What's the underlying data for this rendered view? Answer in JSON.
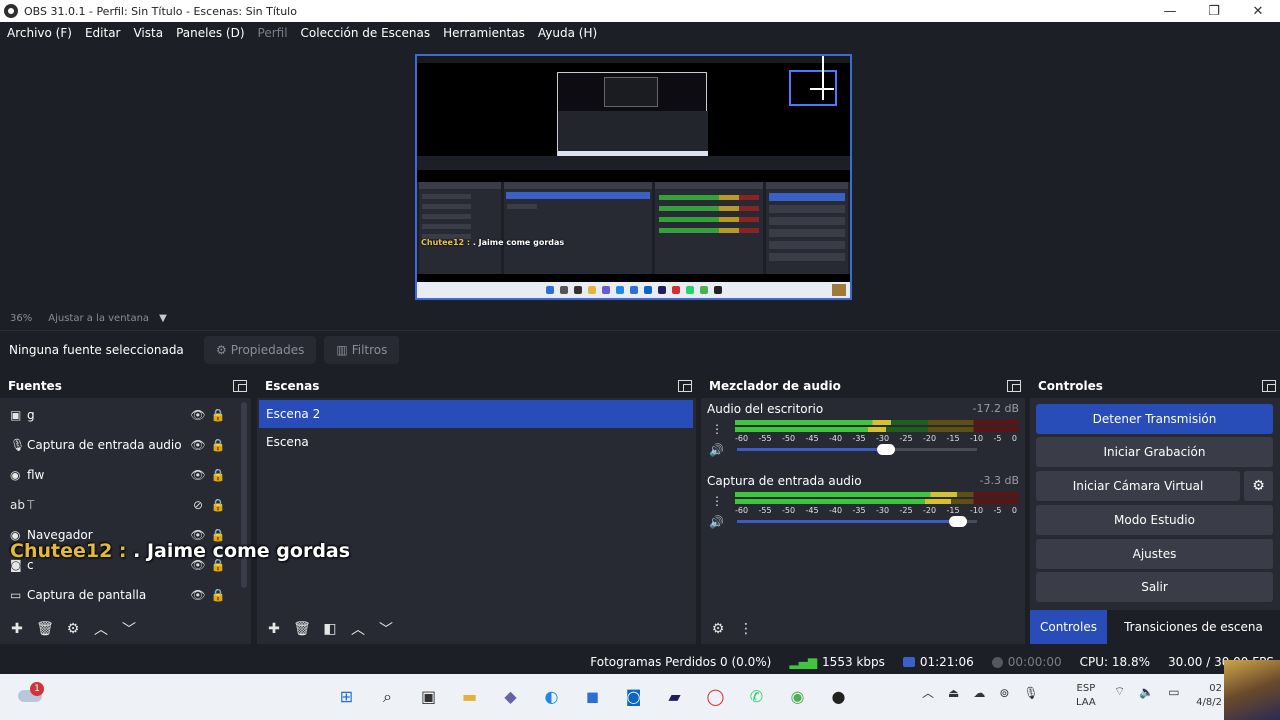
{
  "window": {
    "title": "OBS 31.0.1 - Perfil: Sin Título - Escenas: Sin Título",
    "buttons": {
      "minimize": "—",
      "maximize": "❐",
      "close": "✕"
    }
  },
  "menu": [
    {
      "label": "Archivo (F)",
      "disabled": false
    },
    {
      "label": "Editar",
      "disabled": false
    },
    {
      "label": "Vista",
      "disabled": false
    },
    {
      "label": "Paneles (D)",
      "disabled": false
    },
    {
      "label": "Perfil",
      "disabled": true
    },
    {
      "label": "Colección de Escenas",
      "disabled": false
    },
    {
      "label": "Herramientas",
      "disabled": false
    },
    {
      "label": "Ayuda (H)",
      "disabled": false
    }
  ],
  "preview": {
    "zoom": "36%",
    "fit_label": "Ajustar a la ventana",
    "chat_nick": "Chutee12 :",
    "chat_msg": ". Jaime come gordas"
  },
  "source_toolbar": {
    "no_source": "Ninguna fuente seleccionada",
    "properties": "Propiedades",
    "filters": "Filtros"
  },
  "sources": {
    "title": "Fuentes",
    "items": [
      {
        "name": "g",
        "type_icon": "image-icon",
        "glyph": "▣",
        "visible": true
      },
      {
        "name": "Captura de entrada audio",
        "type_icon": "microphone-icon",
        "glyph": "🎙",
        "visible": true
      },
      {
        "name": "flw",
        "type_icon": "browser-icon",
        "glyph": "◉",
        "visible": true
      },
      {
        "name": "T",
        "type_icon": "text-icon",
        "glyph": "ab",
        "visible": false
      },
      {
        "name": "Navegador",
        "type_icon": "browser-icon",
        "glyph": "◉",
        "visible": true
      },
      {
        "name": "c",
        "type_icon": "camera-icon",
        "glyph": "◙",
        "visible": true
      },
      {
        "name": "Captura de pantalla",
        "type_icon": "monitor-icon",
        "glyph": "▭",
        "visible": true
      }
    ]
  },
  "scenes": {
    "title": "Escenas",
    "items": [
      {
        "name": "Escena 2",
        "active": true
      },
      {
        "name": "Escena",
        "active": false
      }
    ]
  },
  "mixer": {
    "title": "Mezclador de audio",
    "ticks": [
      "-60",
      "-55",
      "-50",
      "-45",
      "-40",
      "-35",
      "-30",
      "-25",
      "-20",
      "-15",
      "-10",
      "-5",
      "0"
    ],
    "channels": [
      {
        "name": "Audio del escritorio",
        "db": "-17.2 dB",
        "level": 0.55,
        "volume": 0.62
      },
      {
        "name": "Captura de entrada audio",
        "db": "-3.3 dB",
        "level": 0.78,
        "volume": 0.92
      }
    ]
  },
  "controls": {
    "title": "Controles",
    "stop_stream": "Detener Transmisión",
    "start_record": "Iniciar Grabación",
    "virtual_cam": "Iniciar Cámara Virtual",
    "studio_mode": "Modo Estudio",
    "settings": "Ajustes",
    "exit": "Salir",
    "tab_controls": "Controles",
    "tab_transitions": "Transiciones de escena"
  },
  "status": {
    "dropped": "Fotogramas Perdidos 0 (0.0%)",
    "bitrate": "1553 kbps",
    "stream_time": "01:21:06",
    "rec_time": "00:00:00",
    "cpu": "CPU: 18.8%",
    "fps": "30.00 / 30.00 FPS"
  },
  "taskbar": {
    "weather_badge": "1",
    "lang_top": "ESP",
    "lang_bottom": "LAA",
    "clock_top": "02",
    "clock_bottom": "4/8/2"
  },
  "colors": {
    "accent": "#284cb8",
    "background": "#1d1f26",
    "panel": "#272a33"
  }
}
